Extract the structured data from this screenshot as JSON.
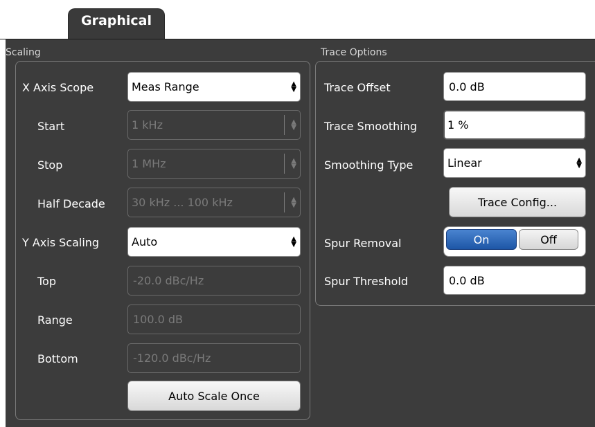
{
  "tab": {
    "label": "Graphical"
  },
  "scaling": {
    "title": "Scaling",
    "x_axis_scope": {
      "label": "X Axis Scope",
      "value": "Meas Range"
    },
    "start": {
      "label": "Start",
      "value": "1 kHz"
    },
    "stop": {
      "label": "Stop",
      "value": "1 MHz"
    },
    "half_decade": {
      "label": "Half Decade",
      "value": "30 kHz ... 100 kHz"
    },
    "y_axis_scaling": {
      "label": "Y Axis Scaling",
      "value": "Auto"
    },
    "top": {
      "label": "Top",
      "value": "-20.0 dBc/Hz"
    },
    "range": {
      "label": "Range",
      "value": "100.0 dB"
    },
    "bottom": {
      "label": "Bottom",
      "value": "-120.0 dBc/Hz"
    },
    "auto_scale_once": "Auto Scale Once"
  },
  "trace_options": {
    "title": "Trace Options",
    "trace_offset": {
      "label": "Trace Offset",
      "value": "0.0 dB"
    },
    "trace_smoothing": {
      "label": "Trace Smoothing",
      "value": "1 %"
    },
    "smoothing_type": {
      "label": "Smoothing Type",
      "value": "Linear"
    },
    "trace_config": "Trace Config...",
    "spur_removal": {
      "label": "Spur Removal",
      "on": "On",
      "off": "Off",
      "selected": "On"
    },
    "spur_threshold": {
      "label": "Spur Threshold",
      "value": "0.0 dB"
    }
  },
  "colors": {
    "panel": "#3c3c3c",
    "toggle_on": "#1d56a6"
  }
}
